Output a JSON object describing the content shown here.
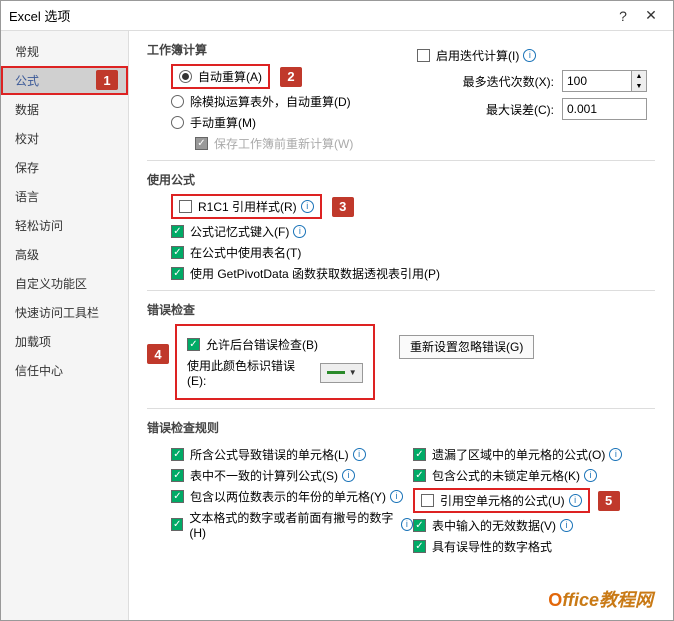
{
  "window": {
    "title": "Excel 选项"
  },
  "sidebar": {
    "items": [
      {
        "label": "常规"
      },
      {
        "label": "公式"
      },
      {
        "label": "数据"
      },
      {
        "label": "校对"
      },
      {
        "label": "保存"
      },
      {
        "label": "语言"
      },
      {
        "label": "轻松访问"
      },
      {
        "label": "高级"
      },
      {
        "label": "自定义功能区"
      },
      {
        "label": "快速访问工具栏"
      },
      {
        "label": "加载项"
      },
      {
        "label": "信任中心"
      }
    ]
  },
  "markers": {
    "m1": "1",
    "m2": "2",
    "m3": "3",
    "m4": "4",
    "m5": "5"
  },
  "calc": {
    "section": "工作簿计算",
    "auto": "自动重算(A)",
    "except": "除模拟运算表外，自动重算(D)",
    "manual": "手动重算(M)",
    "recalc_save": "保存工作簿前重新计算(W)",
    "iter_enable": "启用迭代计算(I)",
    "max_iter_label": "最多迭代次数(X):",
    "max_iter_value": "100",
    "max_change_label": "最大误差(C):",
    "max_change_value": "0.001"
  },
  "formulas": {
    "section": "使用公式",
    "r1c1": "R1C1 引用样式(R)",
    "autocomplete": "公式记忆式键入(F)",
    "table_names": "在公式中使用表名(T)",
    "getpivot": "使用 GetPivotData 函数获取数据透视表引用(P)"
  },
  "errcheck": {
    "section": "错误检查",
    "enable_bg": "允许后台错误检查(B)",
    "color_label": "使用此颜色标识错误(E):",
    "reset_btn": "重新设置忽略错误(G)"
  },
  "rules": {
    "section": "错误检查规则",
    "r1": "所含公式导致错误的单元格(L)",
    "r2": "表中不一致的计算列公式(S)",
    "r3": "包含以两位数表示的年份的单元格(Y)",
    "r4": "文本格式的数字或者前面有撇号的数字(H)",
    "r5": "遗漏了区域中的单元格的公式(O)",
    "r6": "包含公式的未锁定单元格(K)",
    "r7": "引用空单元格的公式(U)",
    "r8": "表中输入的无效数据(V)",
    "r9": "具有误导性的数字格式"
  },
  "watermark": {
    "o": "O",
    "text": "ffice教程网"
  }
}
